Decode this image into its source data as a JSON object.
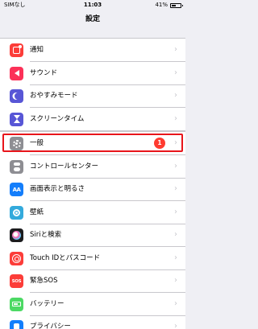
{
  "status_bar": {
    "carrier": "SIMなし",
    "time": "11:03",
    "battery_percent": "41%",
    "battery_level": 0.41
  },
  "nav": {
    "title": "設定"
  },
  "groups": [
    {
      "items": [
        {
          "label": "通知",
          "icon": "notifications-icon",
          "icon_color": "#fc3d39"
        },
        {
          "label": "サウンド",
          "icon": "speaker-icon",
          "icon_color": "#fc3158"
        },
        {
          "label": "おやすみモード",
          "icon": "moon-icon",
          "icon_color": "#5856d6"
        },
        {
          "label": "スクリーンタイム",
          "icon": "hourglass-icon",
          "icon_color": "#5856d6"
        }
      ]
    },
    {
      "items": [
        {
          "label": "一般",
          "icon": "gear-icon",
          "icon_color": "#8e8e93",
          "badge": "1",
          "highlighted": true
        },
        {
          "label": "コントロールセンター",
          "icon": "toggles-icon",
          "icon_color": "#8e8e93"
        },
        {
          "label": "画面表示と明るさ",
          "icon": "text-size-icon",
          "icon_color": "#147efb",
          "icon_text": "AA"
        },
        {
          "label": "壁紙",
          "icon": "wallpaper-icon",
          "icon_color": "#34aadc"
        },
        {
          "label": "Siriと検索",
          "icon": "siri-icon",
          "icon_color": "#1c1c1e"
        },
        {
          "label": "Touch IDとパスコード",
          "icon": "fingerprint-icon",
          "icon_color": "#fc3d39"
        },
        {
          "label": "緊急SOS",
          "icon": "sos-icon",
          "icon_color": "#fc3d39",
          "icon_text": "SOS"
        },
        {
          "label": "バッテリー",
          "icon": "battery-icon",
          "icon_color": "#4cd964"
        },
        {
          "label": "プライバシー",
          "icon": "hand-icon",
          "icon_color": "#147efb"
        }
      ]
    }
  ],
  "chevron": "›",
  "highlight_color": "#e8151b"
}
